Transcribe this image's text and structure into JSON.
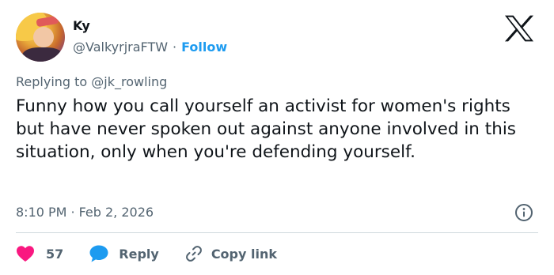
{
  "author": {
    "name": "Ky",
    "handle": "@ValkyrjraFTW",
    "separator": "·",
    "follow_label": "Follow"
  },
  "reply_context": {
    "prefix": "Replying to",
    "mention": "@jk_rowling"
  },
  "tweet": {
    "text": "Funny how you call yourself an activist for women's rights but have never spoken out against anyone involved in this situation, only when you're defending yourself.",
    "time": "8:10 PM",
    "separator": "·",
    "date": "Feb 2, 2026"
  },
  "actions": {
    "like_count": "57",
    "reply_label": "Reply",
    "copy_link_label": "Copy link"
  },
  "icons": {
    "brand": "x-logo-icon",
    "info": "info-icon",
    "like": "heart-icon",
    "reply": "speech-bubble-icon",
    "copy": "link-icon"
  },
  "colors": {
    "text": "#0f1419",
    "secondary": "#536471",
    "accent": "#1d9bf0",
    "like": "#f91880",
    "divider": "#cfd9de"
  }
}
